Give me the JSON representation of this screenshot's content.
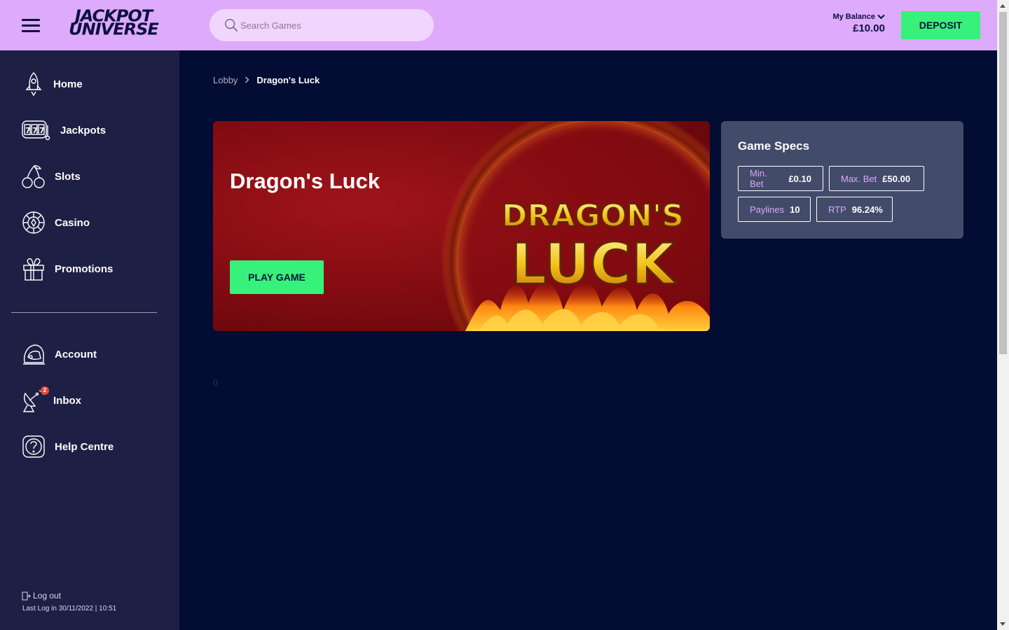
{
  "header": {
    "brand_line1": "JACKPOT",
    "brand_line2": "UNIVERSE",
    "search_placeholder": "Search Games",
    "balance_label": "My Balance",
    "balance_value": "£10.00",
    "deposit_label": "DEPOSIT"
  },
  "sidebar": {
    "items": [
      {
        "label": "Home",
        "icon": "rocket-icon"
      },
      {
        "label": "Jackpots",
        "icon": "slot-777-icon"
      },
      {
        "label": "Slots",
        "icon": "cherries-icon"
      },
      {
        "label": "Casino",
        "icon": "roulette-chip-icon"
      },
      {
        "label": "Promotions",
        "icon": "gift-icon"
      }
    ],
    "account_items": [
      {
        "label": "Account",
        "icon": "astronaut-helmet-icon"
      },
      {
        "label": "Inbox",
        "icon": "satellite-dish-icon",
        "badge": "2"
      },
      {
        "label": "Help Centre",
        "icon": "question-icon"
      }
    ],
    "logout_label": "Log out",
    "last_login": "Last Log in 30/11/2022 | 10:51"
  },
  "breadcrumb": {
    "parent": "Lobby",
    "current": "Dragon's Luck"
  },
  "game": {
    "title": "Dragon's Luck",
    "play_label": "PLAY GAME",
    "art_line1": "DRAGON'S",
    "art_line2": "LUCK"
  },
  "specs": {
    "title": "Game Specs",
    "items": [
      {
        "label": "Min. Bet",
        "value": "£0.10"
      },
      {
        "label": "Max. Bet",
        "value": "£50.00"
      },
      {
        "label": "Paylines",
        "value": "10"
      },
      {
        "label": "RTP",
        "value": "96.24%"
      }
    ]
  },
  "misc": {
    "loader_text": "0"
  },
  "colors": {
    "header_bg": "#deaafb",
    "accent_green": "#37f17b",
    "main_bg": "#030c33",
    "sidebar_bg": "#1e1f45",
    "specs_bg": "#434b6a"
  }
}
